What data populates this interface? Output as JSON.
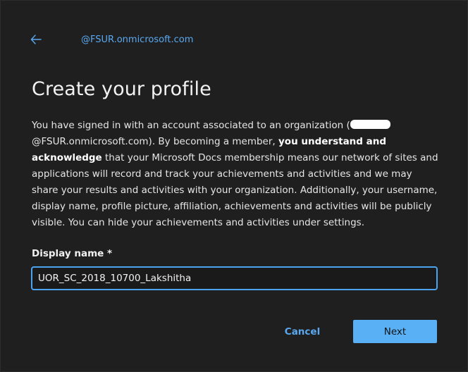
{
  "header": {
    "back_icon": "arrow-left-icon",
    "email": "@FSUR.onmicrosoft.com"
  },
  "title": "Create your profile",
  "description": {
    "part1": "You have signed in with an account associated to an organization (",
    "part2": "@FSUR.onmicrosoft.com). By becoming a member, ",
    "bold": "you understand and acknowledge",
    "part3": " that your Microsoft Docs membership means our network of sites and applications will record and track your achievements and activities and we may share your results and activities with your organization. Additionally, your username, display name, profile picture, affiliation, achievements and activities will be publicly visible. You can hide your achievements and activities under settings."
  },
  "form": {
    "display_name_label": "Display name *",
    "display_name_value": "UOR_SC_2018_10700_Lakshitha"
  },
  "buttons": {
    "cancel": "Cancel",
    "next": "Next"
  },
  "colors": {
    "accent": "#5ab0f4",
    "link": "#5aa9f0",
    "background": "#1f1f1f"
  }
}
